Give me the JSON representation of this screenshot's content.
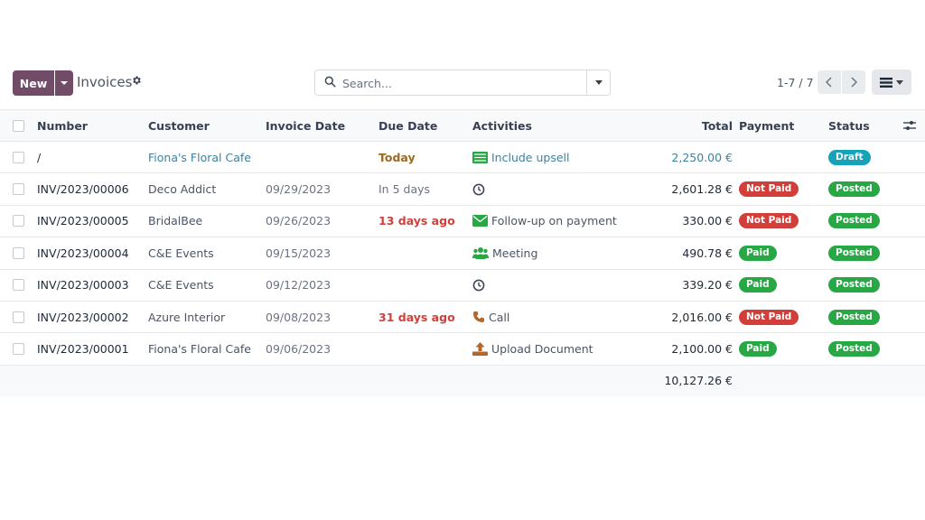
{
  "toolbar": {
    "new_label": "New",
    "title": "Invoices",
    "search_placeholder": "Search...",
    "pager": "1-7 / 7"
  },
  "columns": {
    "number": "Number",
    "customer": "Customer",
    "invoice_date": "Invoice Date",
    "due_date": "Due Date",
    "activities": "Activities",
    "total": "Total",
    "payment": "Payment",
    "status": "Status"
  },
  "rows": [
    {
      "number": "/",
      "customer": "Fiona's Floral Cafe",
      "invoice_date": "",
      "due_date": "Today",
      "due_style": "today",
      "activity_icon": "upsell-icon",
      "activity": "Include upsell",
      "total": "2,250.00 €",
      "payment": "",
      "payment_style": "",
      "status": "Draft",
      "status_style": "teal"
    },
    {
      "number": "INV/2023/00006",
      "customer": "Deco Addict",
      "invoice_date": "09/29/2023",
      "due_date": "In 5 days",
      "due_style": "normal",
      "activity_icon": "clock-icon",
      "activity": "",
      "total": "2,601.28 €",
      "payment": "Not Paid",
      "payment_style": "red",
      "status": "Posted",
      "status_style": "green"
    },
    {
      "number": "INV/2023/00005",
      "customer": "BridalBee",
      "invoice_date": "09/26/2023",
      "due_date": "13 days ago",
      "due_style": "overdue",
      "activity_icon": "envelope-icon",
      "activity": "Follow-up on payment",
      "total": "330.00 €",
      "payment": "Not Paid",
      "payment_style": "red",
      "status": "Posted",
      "status_style": "green"
    },
    {
      "number": "INV/2023/00004",
      "customer": "C&E Events",
      "invoice_date": "09/15/2023",
      "due_date": "",
      "due_style": "normal",
      "activity_icon": "users-icon",
      "activity": "Meeting",
      "total": "490.78 €",
      "payment": "Paid",
      "payment_style": "green",
      "status": "Posted",
      "status_style": "green"
    },
    {
      "number": "INV/2023/00003",
      "customer": "C&E Events",
      "invoice_date": "09/12/2023",
      "due_date": "",
      "due_style": "normal",
      "activity_icon": "clock-icon",
      "activity": "",
      "total": "339.20 €",
      "payment": "Paid",
      "payment_style": "green",
      "status": "Posted",
      "status_style": "green"
    },
    {
      "number": "INV/2023/00002",
      "customer": "Azure Interior",
      "invoice_date": "09/08/2023",
      "due_date": "31 days ago",
      "due_style": "overdue",
      "activity_icon": "phone-icon",
      "activity": "Call",
      "total": "2,016.00 €",
      "payment": "Not Paid",
      "payment_style": "red",
      "status": "Posted",
      "status_style": "green"
    },
    {
      "number": "INV/2023/00001",
      "customer": "Fiona's Floral Cafe",
      "invoice_date": "09/06/2023",
      "due_date": "",
      "due_style": "normal",
      "activity_icon": "upload-icon",
      "activity": "Upload Document",
      "total": "2,100.00 €",
      "payment": "Paid",
      "payment_style": "green",
      "status": "Posted",
      "status_style": "green"
    }
  ],
  "footer": {
    "grand_total": "10,127.26 €"
  },
  "colors": {
    "brand": "#714B67",
    "paid": "#28a745",
    "not_paid": "#d23f3a",
    "draft": "#17a2b8",
    "overdue": "#d23f3a"
  }
}
